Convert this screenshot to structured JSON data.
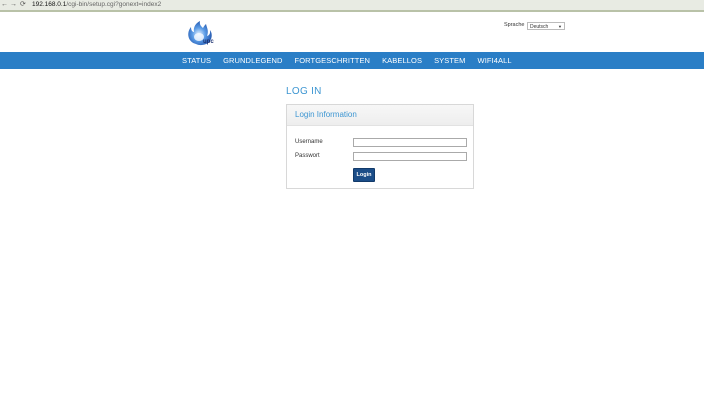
{
  "browser": {
    "url_host": "192.168.0.1",
    "url_path": "/cgi-bin/setup.cgi?gonext=index2"
  },
  "header": {
    "logo_text": "upc",
    "language_label": "Sprache",
    "language_value": "Deutsch"
  },
  "nav": {
    "items": [
      {
        "label": "STATUS"
      },
      {
        "label": "GRUNDLEGEND"
      },
      {
        "label": "FORTGESCHRITTEN"
      },
      {
        "label": "KABELLOS"
      },
      {
        "label": "SYSTEM"
      },
      {
        "label": "WIFI4ALL"
      }
    ]
  },
  "login": {
    "page_title": "LOG IN",
    "panel_title": "Login Information",
    "username_label": "Username",
    "username_value": "",
    "password_label": "Passwort",
    "password_value": "",
    "button_label": "Login"
  },
  "colors": {
    "accent": "#3d96d2",
    "nav_bg": "#2a7ec6",
    "button_bg": "#1b4d88"
  }
}
